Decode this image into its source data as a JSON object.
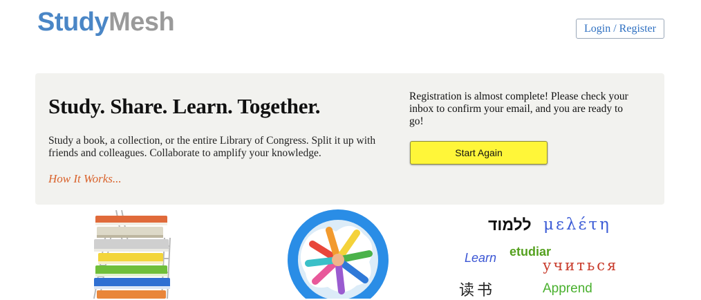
{
  "header": {
    "logo_part1": "Study",
    "logo_part2": "Mesh",
    "login_label": "Login / Register"
  },
  "hero": {
    "headline": "Study. Share. Learn. Together.",
    "blurb": "Study a book, a collection, or the entire Library of Congress. Split it up with friends and colleagues. Collaborate to amplify your knowledge.",
    "how_it_works": "How It Works...",
    "registration_message": "Registration is almost complete! Please check your inbox to confirm your email, and you are ready to go!",
    "start_again_label": "Start Again"
  },
  "words": {
    "hebrew": "ללמוד",
    "greek": "μελέτη",
    "learn": "Learn",
    "spanish": "etudiar",
    "russian": "учиться",
    "chinese": "读书",
    "french": "Apprend"
  },
  "colors": {
    "brand_blue": "#4a86c6",
    "brand_gray": "#9a9a9a",
    "accent_yellow": "#fff639",
    "link_orange": "#d9622b"
  }
}
